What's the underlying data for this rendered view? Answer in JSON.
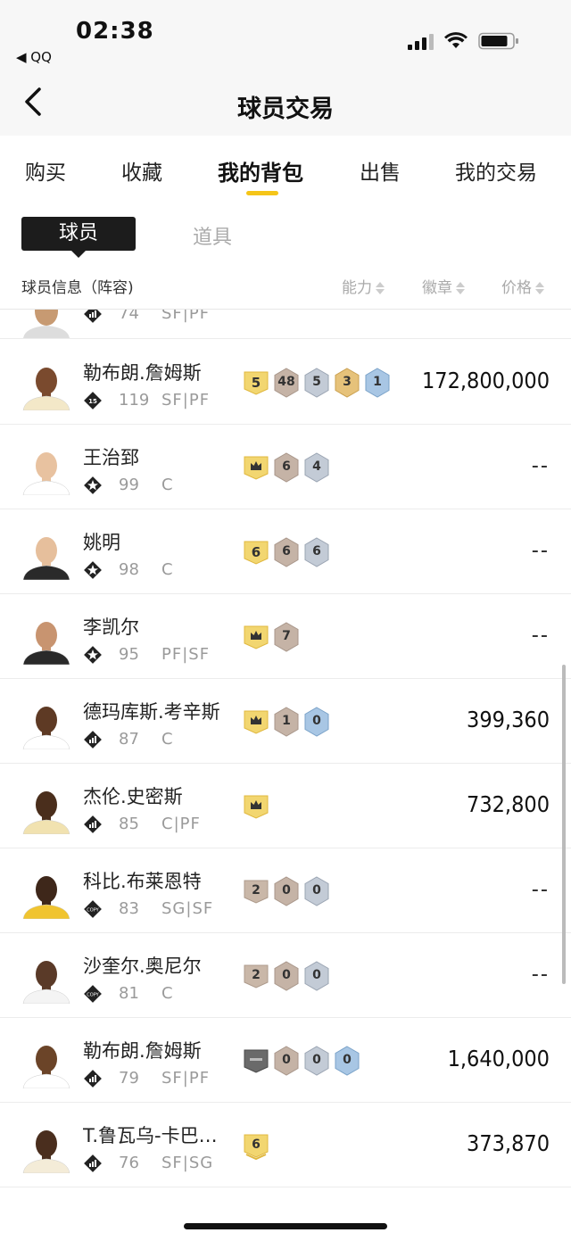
{
  "status": {
    "time": "02:38",
    "back_app": "◀ QQ"
  },
  "nav": {
    "title": "球员交易"
  },
  "tabs": [
    {
      "label": "购买",
      "active": false
    },
    {
      "label": "收藏",
      "active": false
    },
    {
      "label": "我的背包",
      "active": true
    },
    {
      "label": "出售",
      "active": false
    },
    {
      "label": "我的交易",
      "active": false
    }
  ],
  "subtabs": {
    "players": "球员",
    "items": "道具"
  },
  "columns": {
    "info": "球员信息（阵容)",
    "ability": "能力",
    "badges": "徽章",
    "price": "价格"
  },
  "partial_row": {
    "rating": "74",
    "position": "SF|PF"
  },
  "players": [
    {
      "name": "勒布朗.詹姆斯",
      "tier": "15",
      "rating": "119",
      "position": "SF|PF",
      "badges": [
        {
          "type": "gold",
          "text": "5"
        },
        {
          "type": "bronze",
          "text": "48"
        },
        {
          "type": "silver",
          "text": "5"
        },
        {
          "type": "goldhex",
          "text": "3"
        },
        {
          "type": "blue",
          "text": "1"
        }
      ],
      "price": "172,800,000"
    },
    {
      "name": "王治郅",
      "tier": "star",
      "rating": "99",
      "position": "C",
      "badges": [
        {
          "type": "crown",
          "text": ""
        },
        {
          "type": "bronze",
          "text": "6"
        },
        {
          "type": "silver",
          "text": "4"
        }
      ],
      "price": "--"
    },
    {
      "name": "姚明",
      "tier": "star",
      "rating": "98",
      "position": "C",
      "badges": [
        {
          "type": "gold",
          "text": "6"
        },
        {
          "type": "bronze",
          "text": "6"
        },
        {
          "type": "silver",
          "text": "6"
        }
      ],
      "price": "--"
    },
    {
      "name": "李凯尔",
      "tier": "star",
      "rating": "95",
      "position": "PF|SF",
      "badges": [
        {
          "type": "crown",
          "text": ""
        },
        {
          "type": "bronze",
          "text": "7"
        }
      ],
      "price": "--"
    },
    {
      "name": "德玛库斯.考辛斯",
      "tier": "bars",
      "rating": "87",
      "position": "C",
      "badges": [
        {
          "type": "crown",
          "text": ""
        },
        {
          "type": "bronze",
          "text": "1"
        },
        {
          "type": "blue",
          "text": "0"
        }
      ],
      "price": "399,360"
    },
    {
      "name": "杰伦.史密斯",
      "tier": "bars",
      "rating": "85",
      "position": "C|PF",
      "badges": [
        {
          "type": "crown",
          "text": ""
        }
      ],
      "price": "732,800"
    },
    {
      "name": "科比.布莱恩特",
      "tier": "copy",
      "rating": "83",
      "position": "SG|SF",
      "badges": [
        {
          "type": "tan",
          "text": "2"
        },
        {
          "type": "bronze",
          "text": "0"
        },
        {
          "type": "silver",
          "text": "0"
        }
      ],
      "price": "--"
    },
    {
      "name": "沙奎尔.奥尼尔",
      "tier": "copy",
      "rating": "81",
      "position": "C",
      "badges": [
        {
          "type": "tan",
          "text": "2"
        },
        {
          "type": "bronze",
          "text": "0"
        },
        {
          "type": "silver",
          "text": "0"
        }
      ],
      "price": "--"
    },
    {
      "name": "勒布朗.詹姆斯",
      "tier": "bars",
      "rating": "79",
      "position": "SF|PF",
      "badges": [
        {
          "type": "dark",
          "text": ""
        },
        {
          "type": "bronze",
          "text": "0"
        },
        {
          "type": "silver",
          "text": "0"
        },
        {
          "type": "blue",
          "text": "0"
        }
      ],
      "price": "1,640,000"
    },
    {
      "name": "T.鲁瓦乌-卡巴…",
      "tier": "bars",
      "rating": "76",
      "position": "SF|SG",
      "badges": [
        {
          "type": "goldchev",
          "text": "6"
        }
      ],
      "price": "373,870"
    }
  ],
  "colors": {
    "accent": "#f5c518",
    "gold_badge": "#f0d060",
    "bronze_badge": "#b8a89c",
    "silver_badge": "#aeb6c2",
    "blue_badge": "#8fb3d6"
  }
}
